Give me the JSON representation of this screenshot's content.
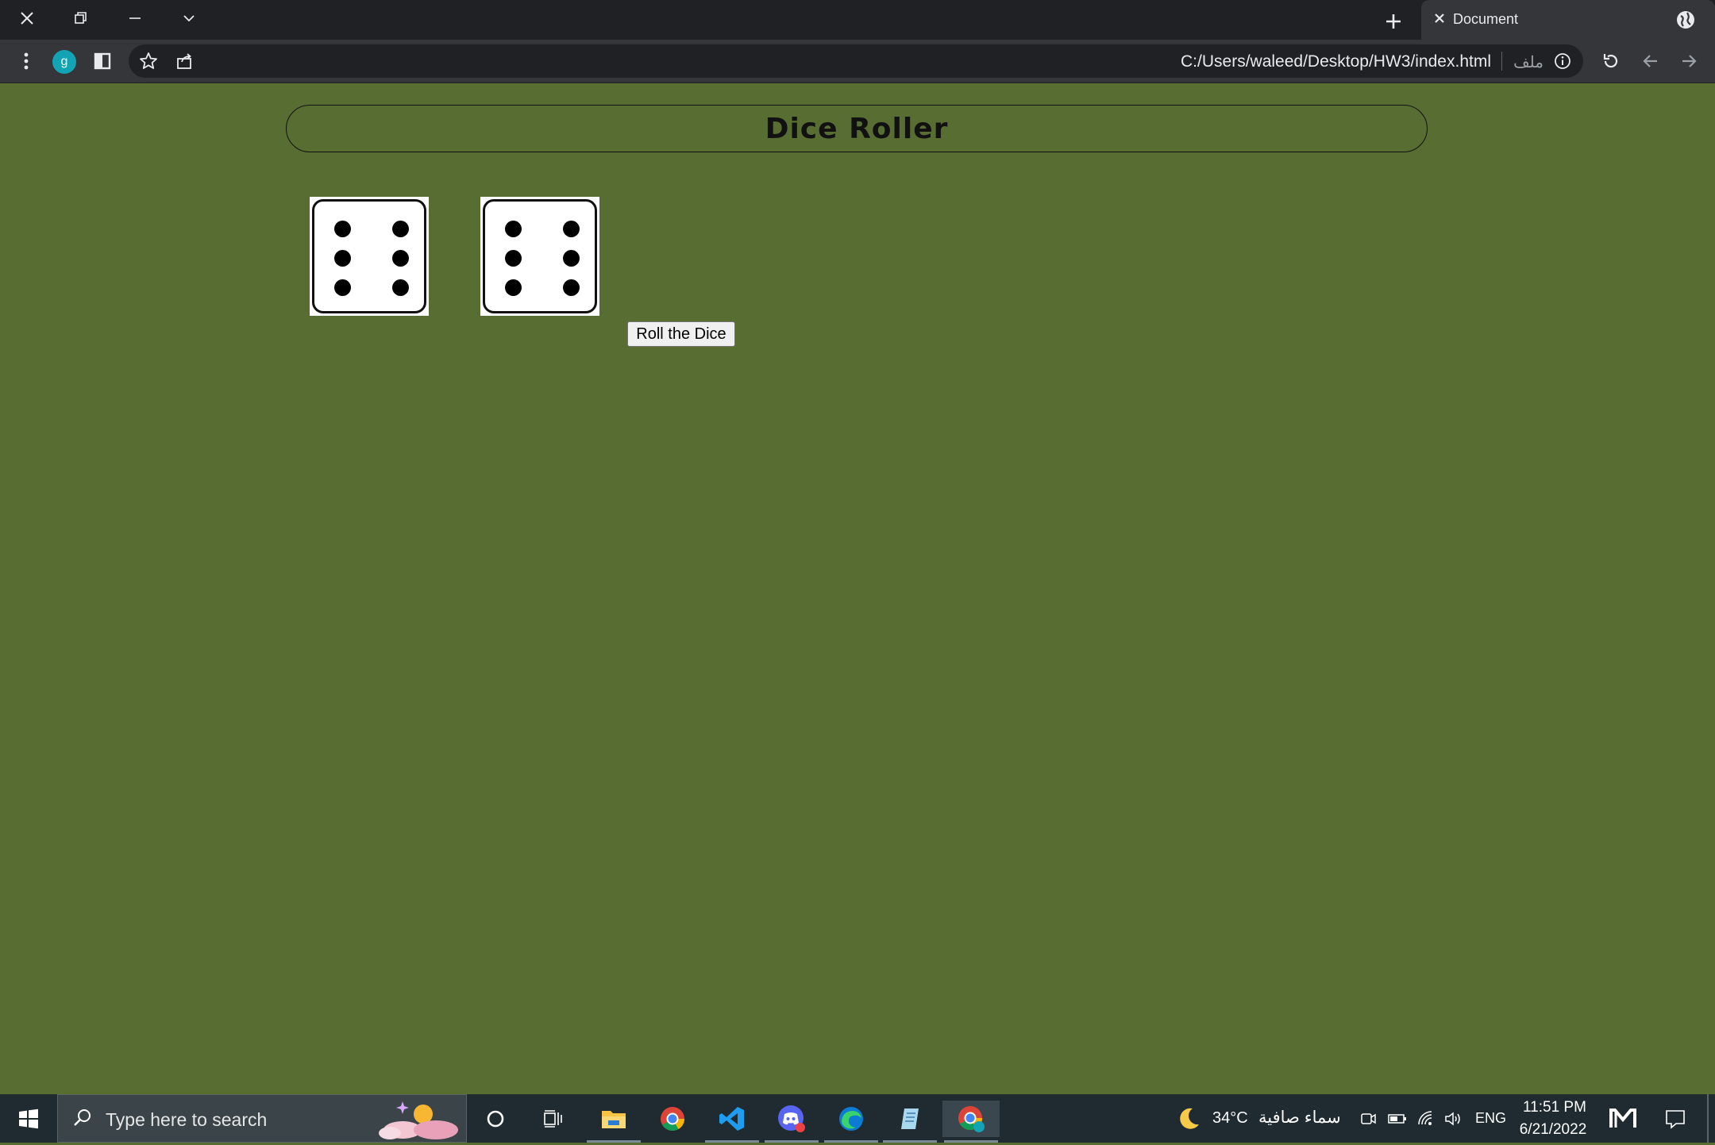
{
  "browser": {
    "tab_title": "Document",
    "url": "C:/Users/waleed/Desktop/HW3/index.html",
    "url_label": "ملف",
    "profile_letter": "g"
  },
  "page": {
    "title": "Dice Roller",
    "dice": [
      6,
      6
    ],
    "roll_button_label": "Roll the Dice"
  },
  "taskbar": {
    "search_placeholder": "Type here to search",
    "weather_temp": "34°C",
    "weather_desc": "سماء صافية",
    "language": "ENG",
    "time": "11:51 PM",
    "date": "6/21/2022",
    "apps": [
      "cortana-icon",
      "task-view-icon",
      "file-explorer-icon",
      "chrome-icon",
      "vscode-icon",
      "discord-icon",
      "edge-icon",
      "notepad-icon",
      "chrome-profile-icon"
    ]
  },
  "colors": {
    "page_background": "#586d31",
    "chrome_dark": "#202124",
    "chrome_toolbar": "#35363a",
    "taskbar": "#1f2b31"
  }
}
